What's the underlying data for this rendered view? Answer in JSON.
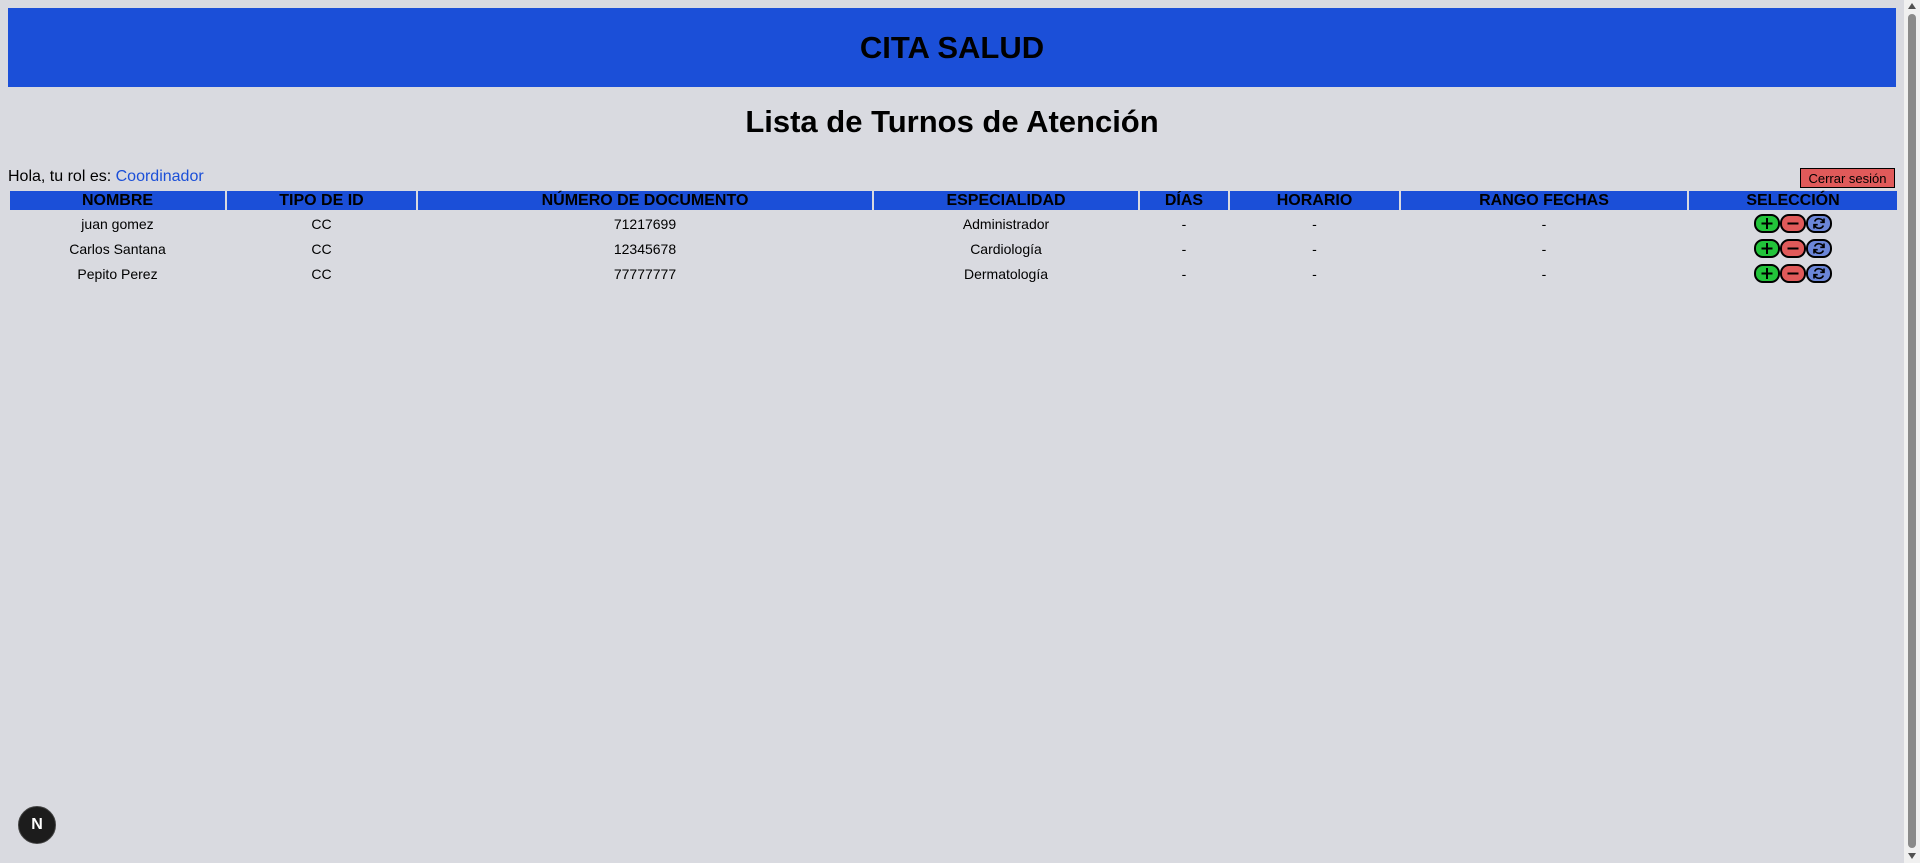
{
  "header": {
    "app_title": "CITA SALUD"
  },
  "page": {
    "title": "Lista de Turnos de Atención",
    "greeting_prefix": "Hola, tu rol es: ",
    "role": "Coordinador",
    "logout_label": "Cerrar sesión"
  },
  "table": {
    "columns": [
      "NOMBRE",
      "TIPO DE ID",
      "NÚMERO DE DOCUMENTO",
      "ESPECIALIDAD",
      "DÍAS",
      "HORARIO",
      "RANGO FECHAS",
      "SELECCIÓN"
    ],
    "rows": [
      {
        "nombre": "juan gomez",
        "tipo_id": "CC",
        "documento": "71217699",
        "especialidad": "Administrador",
        "dias": "-",
        "horario": "-",
        "rango": "-"
      },
      {
        "nombre": "Carlos Santana",
        "tipo_id": "CC",
        "documento": "12345678",
        "especialidad": "Cardiología",
        "dias": "-",
        "horario": "-",
        "rango": "-"
      },
      {
        "nombre": "Pepito Perez",
        "tipo_id": "CC",
        "documento": "77777777",
        "especialidad": "Dermatología",
        "dias": "-",
        "horario": "-",
        "rango": "-"
      }
    ]
  },
  "badge": {
    "letter": "N",
    "icon": "nextjs-icon"
  },
  "colors": {
    "primary": "#1b4fd8",
    "background": "#d9dae0",
    "danger": "#e05a5a",
    "success": "#22c43a",
    "refresh": "#6b86d8"
  }
}
